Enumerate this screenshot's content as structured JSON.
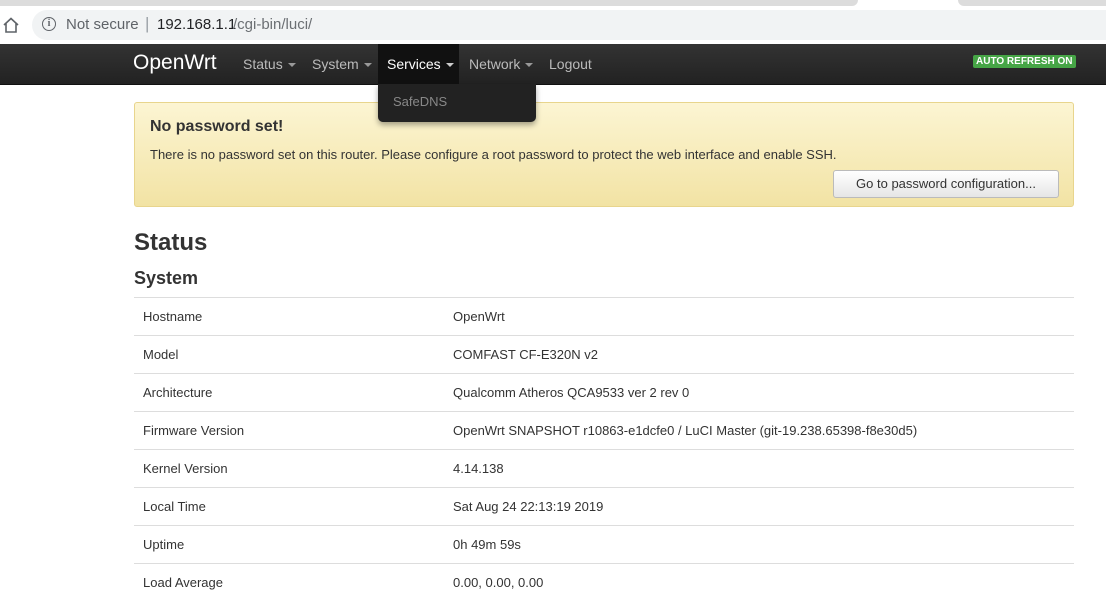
{
  "browser": {
    "security_label": "Not secure",
    "url_host": "192.168.1.1",
    "url_path": "/cgi-bin/luci/",
    "icons": [
      "home-icon",
      "info-icon"
    ]
  },
  "navbar": {
    "brand": "OpenWrt",
    "items": [
      {
        "label": "Status",
        "has_caret": true
      },
      {
        "label": "System",
        "has_caret": true
      },
      {
        "label": "Services",
        "has_caret": true,
        "active": true
      },
      {
        "label": "Network",
        "has_caret": true
      },
      {
        "label": "Logout",
        "has_caret": false
      }
    ],
    "auto_refresh": "AUTO REFRESH ON",
    "auto_refresh_color": "#46a546"
  },
  "services_dropdown": {
    "items": [
      {
        "label": "SafeDNS"
      }
    ]
  },
  "alert": {
    "title": "No password set!",
    "message": "There is no password set on this router. Please configure a root password to protect the web interface and enable SSH.",
    "button": "Go to password configuration..."
  },
  "page": {
    "title": "Status",
    "section": "System"
  },
  "system_table": [
    {
      "label": "Hostname",
      "value": "OpenWrt"
    },
    {
      "label": "Model",
      "value": "COMFAST CF-E320N v2"
    },
    {
      "label": "Architecture",
      "value": "Qualcomm Atheros QCA9533 ver 2 rev 0"
    },
    {
      "label": "Firmware Version",
      "value": "OpenWrt SNAPSHOT r10863-e1dcfe0 / LuCI Master (git-19.238.65398-f8e30d5)"
    },
    {
      "label": "Kernel Version",
      "value": "4.14.138"
    },
    {
      "label": "Local Time",
      "value": "Sat Aug 24 22:13:19 2019"
    },
    {
      "label": "Uptime",
      "value": "0h 49m 59s"
    },
    {
      "label": "Load Average",
      "value": "0.00, 0.00, 0.00"
    }
  ]
}
